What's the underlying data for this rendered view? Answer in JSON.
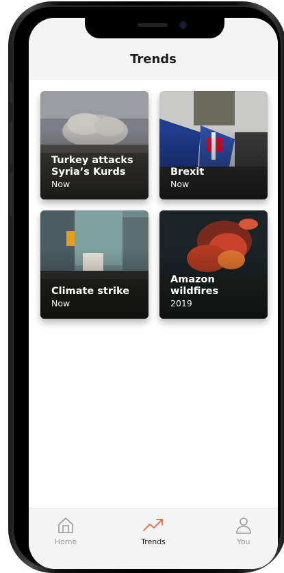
{
  "header": {
    "title": "Trends"
  },
  "cards": [
    {
      "title": "Turkey attacks Syria’s Kurds",
      "subtitle": "Now"
    },
    {
      "title": "Brexit",
      "subtitle": "Now"
    },
    {
      "title": "Climate strike",
      "subtitle": "Now"
    },
    {
      "title": "Amazon wildfires",
      "subtitle": "2019"
    }
  ],
  "nav": {
    "items": [
      {
        "label": "Home",
        "icon": "home-icon",
        "active": false
      },
      {
        "label": "Trends",
        "icon": "trending-up-icon",
        "active": true
      },
      {
        "label": "You",
        "icon": "user-icon",
        "active": false
      }
    ]
  },
  "colors": {
    "accent": "#e8623a",
    "header_bg": "#f4f4f4",
    "text": "#1b1b1b",
    "inactive": "#9a9a9a"
  }
}
